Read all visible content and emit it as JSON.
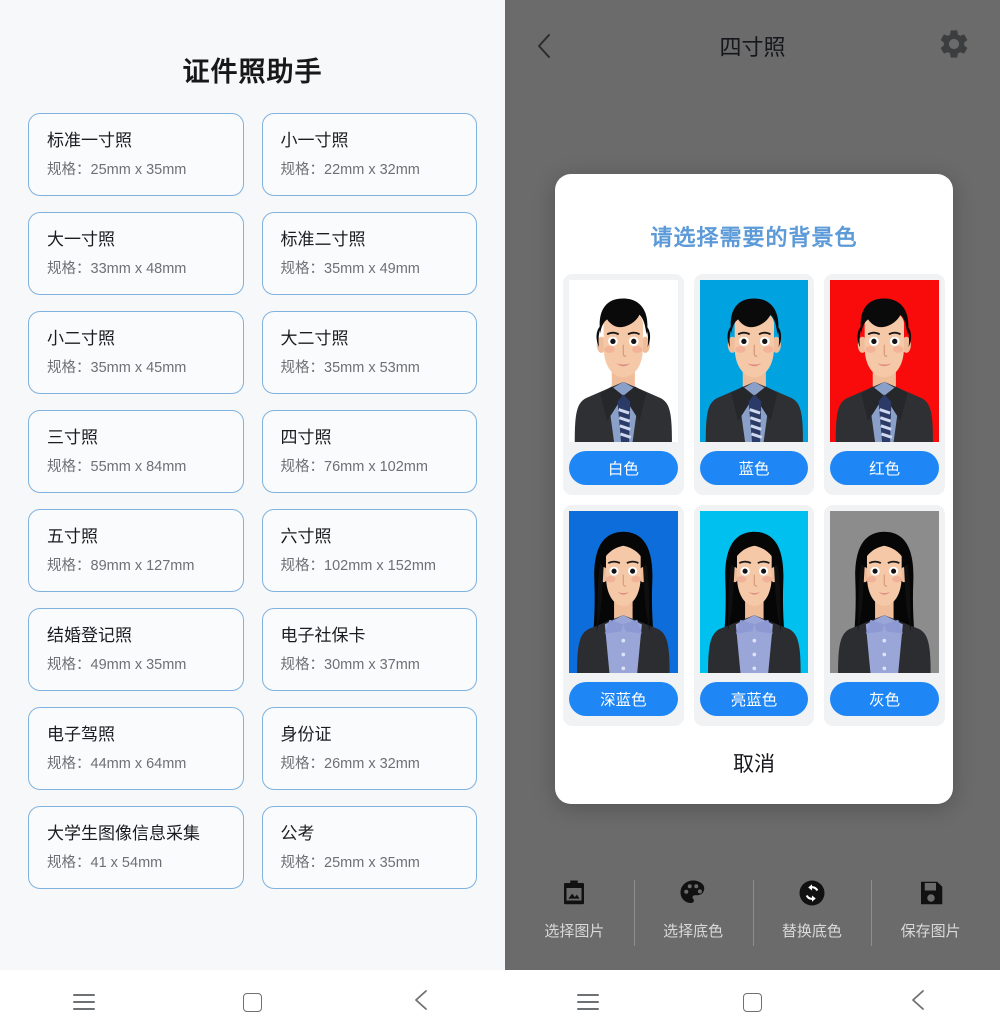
{
  "left": {
    "app_title": "证件照助手",
    "photo_sizes": [
      {
        "name": "标准一寸照",
        "spec": "规格：25mm x 35mm"
      },
      {
        "name": "小一寸照",
        "spec": "规格：22mm x 32mm"
      },
      {
        "name": "大一寸照",
        "spec": "规格：33mm x 48mm"
      },
      {
        "name": "标准二寸照",
        "spec": "规格：35mm x 49mm"
      },
      {
        "name": "小二寸照",
        "spec": "规格：35mm x 45mm"
      },
      {
        "name": "大二寸照",
        "spec": "规格：35mm x 53mm"
      },
      {
        "name": "三寸照",
        "spec": "规格：55mm x 84mm"
      },
      {
        "name": "四寸照",
        "spec": "规格：76mm x 102mm"
      },
      {
        "name": "五寸照",
        "spec": "规格：89mm x 127mm"
      },
      {
        "name": "六寸照",
        "spec": "规格：102mm x 152mm"
      },
      {
        "name": "结婚登记照",
        "spec": "规格：49mm x 35mm"
      },
      {
        "name": "电子社保卡",
        "spec": "规格：30mm x 37mm"
      },
      {
        "name": "电子驾照",
        "spec": "规格：44mm x 64mm"
      },
      {
        "name": "身份证",
        "spec": "规格：26mm x 32mm"
      },
      {
        "name": "大学生图像信息采集",
        "spec": "规格：41 x 54mm"
      },
      {
        "name": "公考",
        "spec": "规格：25mm x 35mm"
      }
    ]
  },
  "right": {
    "header": {
      "back_icon": "chevron-left-icon",
      "title": "四寸照",
      "settings_icon": "gear-icon"
    },
    "dialog": {
      "title": "请选择需要的背景色",
      "cancel_label": "取消",
      "options": [
        {
          "label": "白色",
          "bg": "#ffffff",
          "portrait": "male"
        },
        {
          "label": "蓝色",
          "bg": "#00a3e0",
          "portrait": "male"
        },
        {
          "label": "红色",
          "bg": "#fa0b0b",
          "portrait": "male"
        },
        {
          "label": "深蓝色",
          "bg": "#0d6edb",
          "portrait": "female"
        },
        {
          "label": "亮蓝色",
          "bg": "#00c0f0",
          "portrait": "female"
        },
        {
          "label": "灰色",
          "bg": "#8c8c8c",
          "portrait": "female"
        }
      ]
    },
    "toolbar": [
      {
        "label": "选择图片",
        "icon": "image-picker-icon"
      },
      {
        "label": "选择底色",
        "icon": "palette-icon"
      },
      {
        "label": "替换底色",
        "icon": "refresh-swap-icon"
      },
      {
        "label": "保存图片",
        "icon": "save-floppy-icon"
      }
    ]
  },
  "nav": {
    "menu_icon": "hamburger-icon",
    "home_icon": "square-home-icon",
    "back_icon": "chevron-left-icon"
  },
  "colors": {
    "accent_blue": "#1f87f5",
    "card_border": "#7fb2de",
    "dialog_title": "#5d9ad8",
    "overlay_gray": "#6b6b6b"
  }
}
